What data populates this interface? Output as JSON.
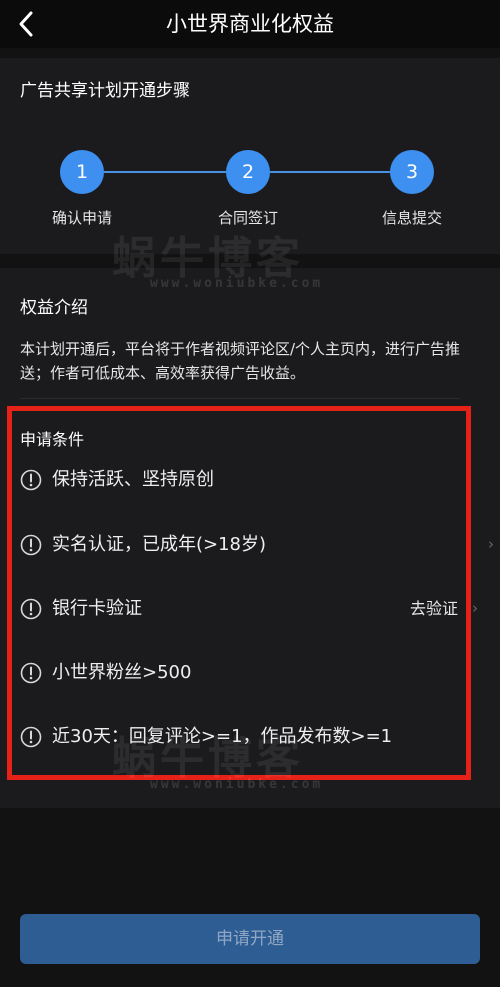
{
  "header": {
    "title": "小世界商业化权益",
    "back_icon": "chevron-left-icon"
  },
  "steps_section": {
    "title": "广告共享计划开通步骤",
    "steps": [
      {
        "number": "1",
        "label": "确认申请"
      },
      {
        "number": "2",
        "label": "合同签订"
      },
      {
        "number": "3",
        "label": "信息提交"
      }
    ]
  },
  "benefits": {
    "title": "权益介绍",
    "text": "本计划开通后，平台将于作者视频评论区/个人主页内，进行广告推送；作者可低成本、高效率获得广告收益。"
  },
  "conditions": {
    "title": "申请条件",
    "items": [
      {
        "text": "保持活跃、坚持原创"
      },
      {
        "text": "实名认证，已成年(>18岁)"
      },
      {
        "text": "银行卡验证",
        "action": "去验证"
      },
      {
        "text": "小世界粉丝>500"
      },
      {
        "text": "近30天：回复评论>=1，作品发布数>=1"
      }
    ]
  },
  "footer": {
    "apply_label": "申请开通"
  },
  "watermark": {
    "brand": "蜗牛博客",
    "url": "www.woniubke.com"
  },
  "colors": {
    "accent": "#3d8ff0",
    "button_bg": "#2e5d93",
    "highlight_border": "#e62117",
    "background": "#121213",
    "section_bg": "#1b1b1d"
  }
}
